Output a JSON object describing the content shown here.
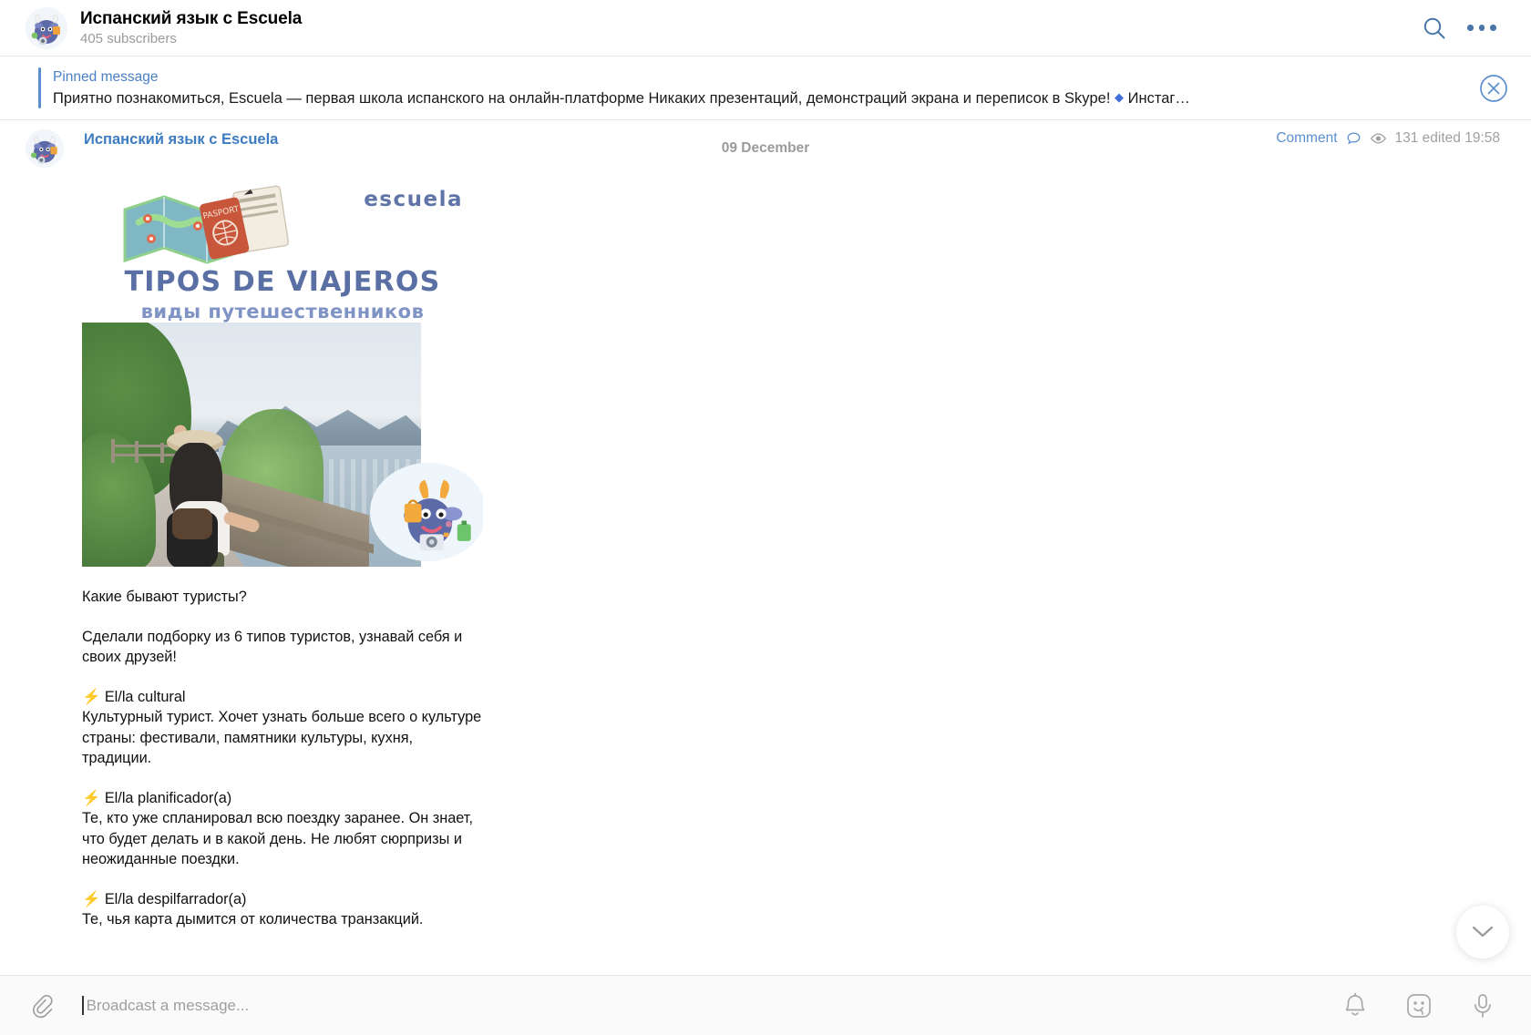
{
  "header": {
    "channel_title": "Испанский язык с Escuela",
    "subscribers": "405 subscribers",
    "search_icon": "search-icon",
    "menu_icon": "more-options-icon"
  },
  "pinned": {
    "label": "Pinned message",
    "text_part1": "Приятно познакомиться, Escuela — первая школа испанского на онлайн-платформе  Никаких презентаций, демонстраций экрана и переписок в Skype!",
    "diamond": "◆",
    "text_part2": "Инстаг…",
    "close_icon": "close-circle-icon"
  },
  "chat": {
    "date_divider": "09 December",
    "scroll_down_icon": "chevron-down-icon"
  },
  "post": {
    "author": "Испанский язык с Escuela",
    "comment_label": "Comment",
    "comment_icon": "comment-bubble-icon",
    "views_icon": "eye-icon",
    "views_meta": "131 edited 19:58",
    "image": {
      "logo": "escuela",
      "title": "TIPOS DE VIAJEROS",
      "subtitle": "виды путешественников"
    },
    "text": {
      "line1": "Какие бывают туристы?",
      "line2": "Сделали подборку из 6 типов туристов, узнавай себя и своих друзей!",
      "item1_emoji": "⚡",
      "item1_title": "El/la cultural",
      "item1_body": "Культурный турист. Хочет узнать больше всего о культуре страны: фестивали, памятники культуры, кухня, традиции.",
      "item2_emoji": "⚡",
      "item2_title": "El/la planificador(a)",
      "item2_body": "Те, кто уже спланировал всю поездку заранее. Он знает, что будет делать и в какой день. Не любят сюрпризы и неожиданные поездки.",
      "item3_emoji": "⚡",
      "item3_title": "El/la despilfarrador(a)",
      "item3_body": "Те, чья карта дымится от количества транзакций."
    }
  },
  "composer": {
    "attach_icon": "paperclip-icon",
    "placeholder": "Broadcast a message...",
    "bell_icon": "notification-bell-icon",
    "sticker_icon": "sticker-face-icon",
    "mic_icon": "microphone-icon"
  },
  "colors": {
    "accent_blue": "#4a80c4",
    "link_blue": "#3c7cc0",
    "muted_gray": "#9a9a9a"
  }
}
